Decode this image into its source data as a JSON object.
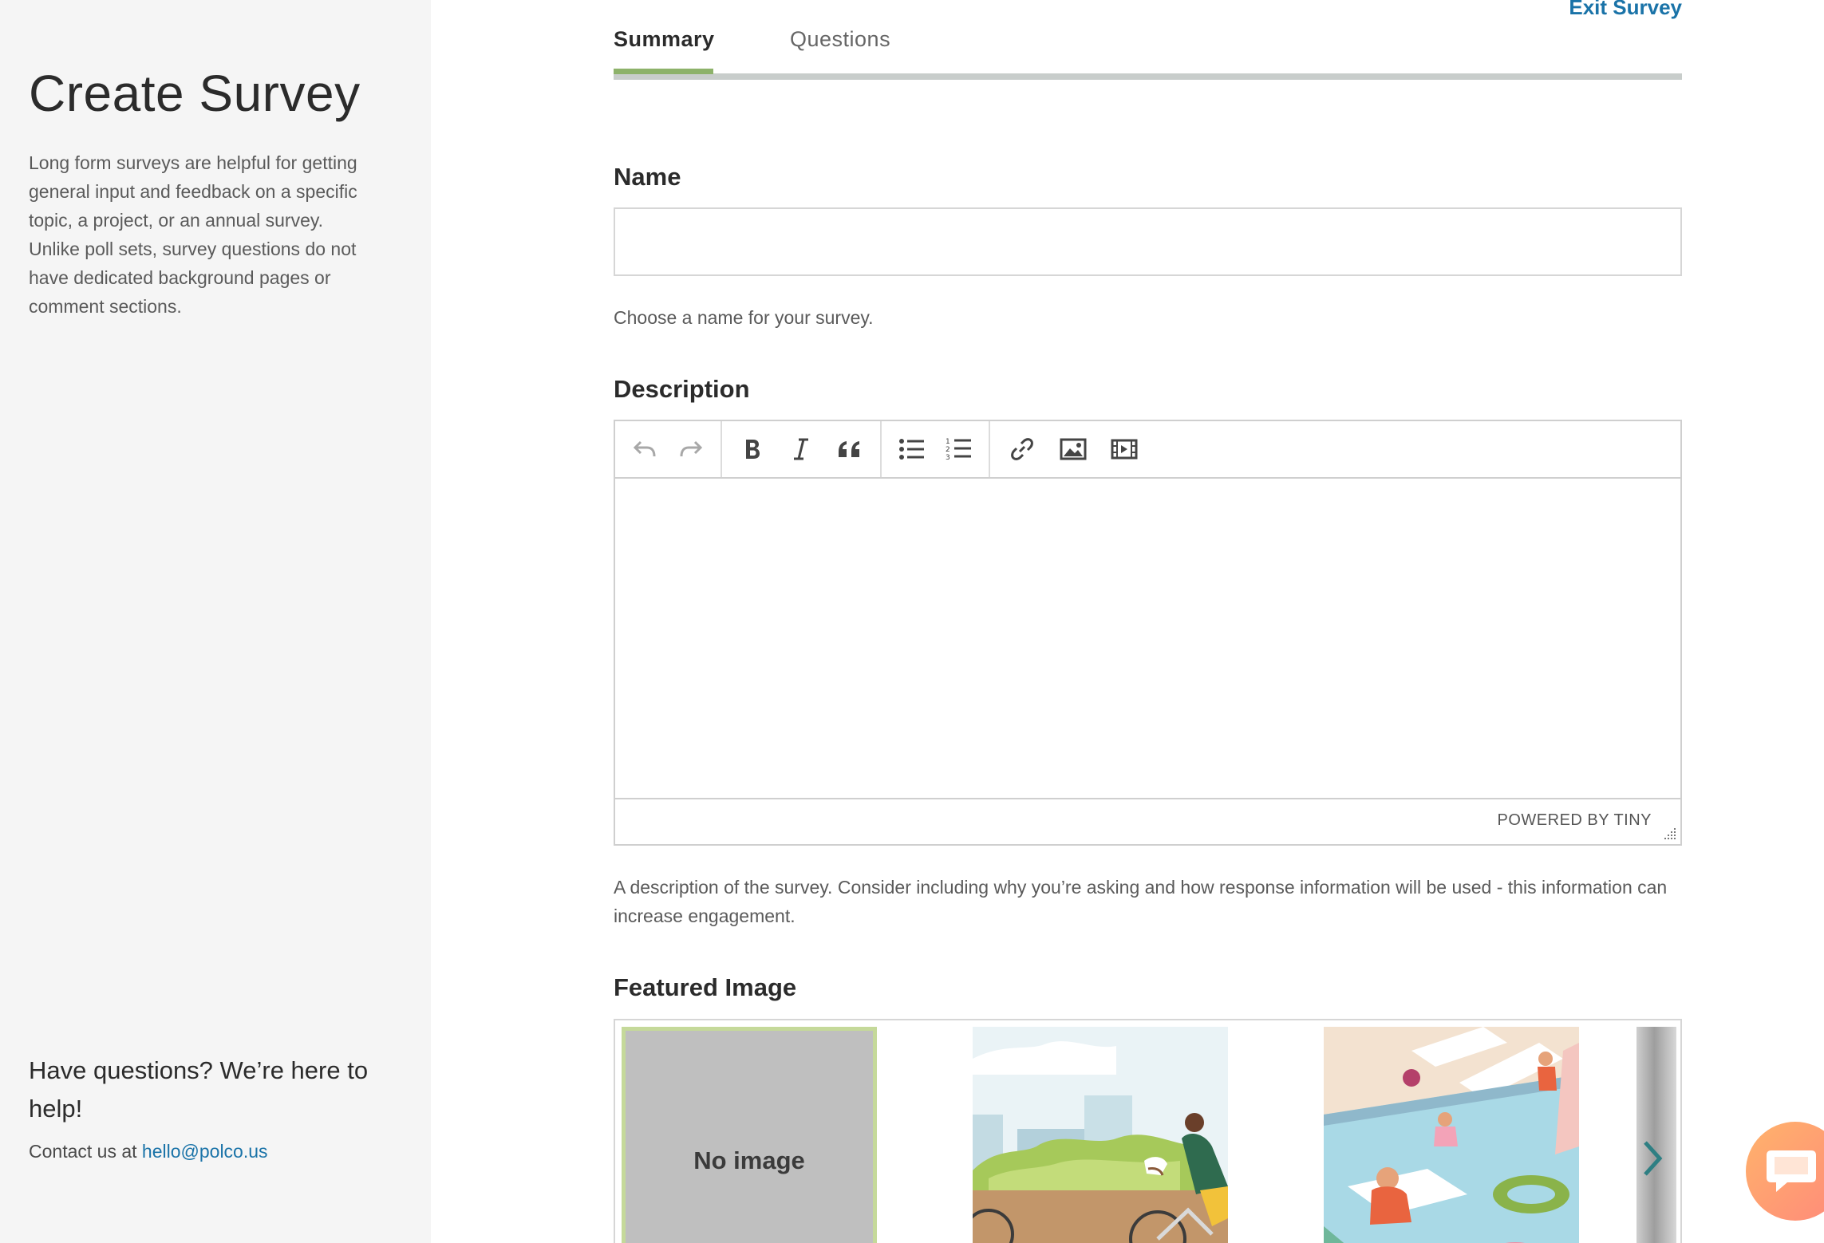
{
  "sidebar": {
    "title": "Create Survey",
    "description": "Long form surveys are helpful for getting general input and feedback on a specific topic, a project, or an annual survey. Unlike poll sets, survey questions do not have dedicated background pages or comment sections.",
    "help_title": "Have questions? We’re here to help!",
    "contact_prefix": "Contact us at ",
    "contact_email": "hello@polco.us"
  },
  "header": {
    "exit_label": "Exit Survey",
    "tabs": [
      {
        "label": "Summary",
        "active": true
      },
      {
        "label": "Questions",
        "active": false
      }
    ]
  },
  "form": {
    "name": {
      "label": "Name",
      "value": "",
      "placeholder": "",
      "hint": "Choose a name for your survey."
    },
    "description": {
      "label": "Description",
      "toolbar": [
        "undo-icon",
        "redo-icon",
        "bold-icon",
        "italic-icon",
        "blockquote-icon",
        "bullet-list-icon",
        "numbered-list-icon",
        "link-icon",
        "image-icon",
        "video-icon"
      ],
      "powered_by": "POWERED BY TINY",
      "hint": "A description of the survey. Consider including why you’re asking and how response information will be used - this information can increase engagement."
    },
    "featured_image": {
      "label": "Featured Image",
      "no_image_label": "No image"
    }
  },
  "colors": {
    "accent_green": "#8db26a",
    "link_blue": "#1a73a8",
    "chat_orange": "#ff9a70"
  }
}
